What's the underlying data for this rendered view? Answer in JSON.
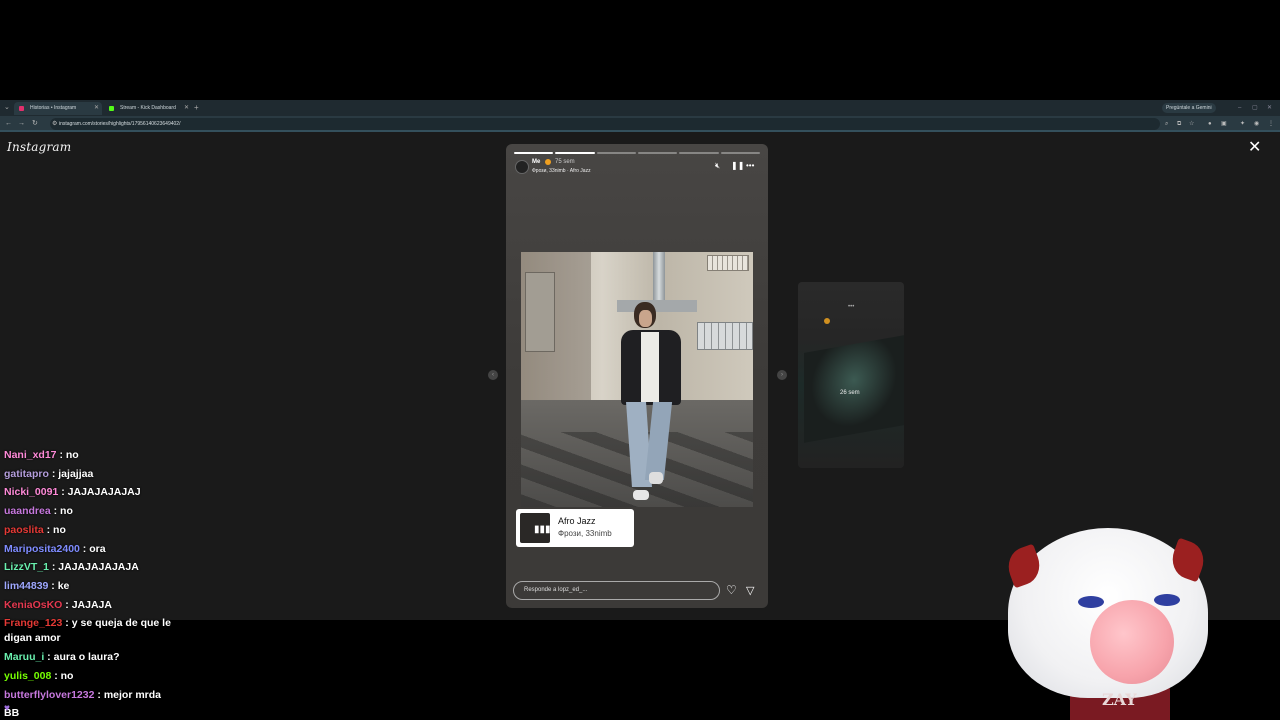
{
  "browser": {
    "tabs": [
      {
        "label": "Historias • Instagram",
        "favicon_color": "#e1306c",
        "active": true
      },
      {
        "label": "Stream - Kick Dashboard",
        "favicon_color": "#53fc18",
        "active": false
      }
    ],
    "gemini_label": "Pregúntale a Gemini",
    "url": "instagram.com/stories/highlights/17956140623649402/"
  },
  "instagram": {
    "logo": "Instagram",
    "story": {
      "username": "Me",
      "time_ago": "75 sem",
      "music_line": "Фрози, 33nimb · Afro Jazz",
      "progress_segments": 6,
      "progress_done": 2,
      "music_card": {
        "title": "Afro Jazz",
        "artist": "Фрози, 33nimb"
      },
      "reply_placeholder": "Responde a lopz_ed_..."
    },
    "next_story": {
      "time_ago": "26 sem"
    }
  },
  "chat": [
    {
      "user": "Nani_xd17",
      "color": "#ff8ad8",
      "text": "no"
    },
    {
      "user": "gatitapro",
      "color": "#b39ddb",
      "text": "jajajjaa"
    },
    {
      "user": "Nicki_0091",
      "color": "#ff8ad8",
      "text": "JAJAJAJAJAJ"
    },
    {
      "user": "uaandrea",
      "color": "#c678dd",
      "text": "no"
    },
    {
      "user": "paoslita",
      "color": "#e53935",
      "text": "no"
    },
    {
      "user": "Mariposita2400",
      "color": "#7f8cff",
      "text": "ora"
    },
    {
      "user": "LizzVT_1",
      "color": "#69f0ae",
      "text": "JAJAJAJAJAJA"
    },
    {
      "user": "lim44839",
      "color": "#9fa8ff",
      "text": "ke"
    },
    {
      "user": "KeniaOsKO",
      "color": "#e53950",
      "text": "JAJAJA"
    },
    {
      "user": "Frange_123",
      "color": "#e53935",
      "text": "y se queja de que le digan amor"
    },
    {
      "user": "Maruu_i",
      "color": "#69f0ae",
      "text": "aura o laura?"
    },
    {
      "user": "yulis_008",
      "color": "#76ff03",
      "text": "no"
    },
    {
      "user": "butterflylover1232",
      "color": "#c678dd",
      "text": "mejor mrda BB"
    }
  ],
  "vtuber": {
    "label": "ZAY"
  }
}
